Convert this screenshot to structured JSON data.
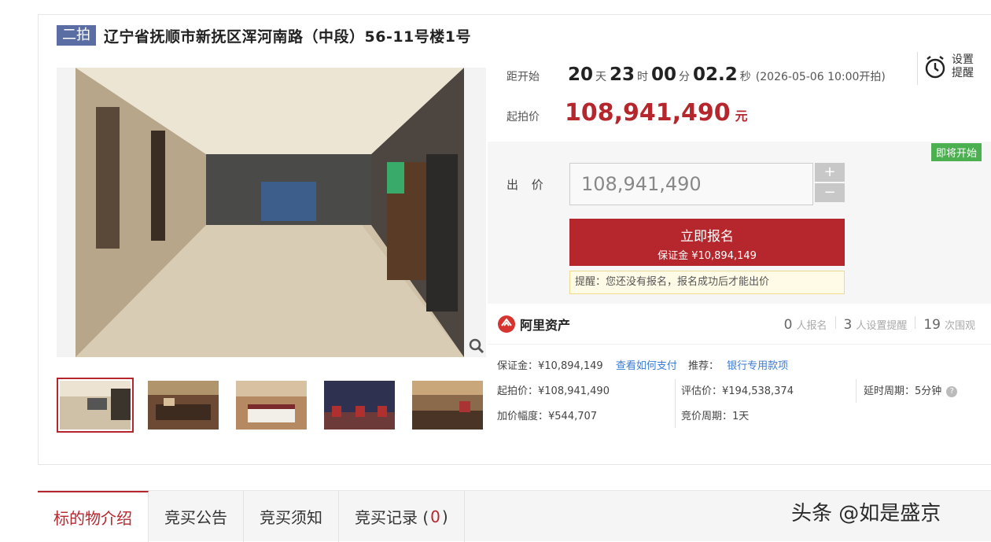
{
  "title": {
    "badge": "二拍",
    "text": "辽宁省抚顺市新抚区浑河南路（中段）56-11号楼1号"
  },
  "countdown": {
    "label": "距开始",
    "days": "20",
    "days_unit": "天",
    "hours": "23",
    "hours_unit": "时",
    "minutes": "00",
    "minutes_unit": "分",
    "seconds": "02.2",
    "seconds_unit": "秒",
    "note": "(2026-05-06 10:00开拍)"
  },
  "alarm": {
    "line1": "设置",
    "line2": "提醒"
  },
  "start_price": {
    "label": "起拍价",
    "value": "108,941,490",
    "unit": "元"
  },
  "status_tag": "即将开始",
  "bid": {
    "label": "出 价",
    "value": "108,941,490",
    "plus": "+",
    "minus": "−",
    "signup_label": "立即报名",
    "deposit_note": "保证金 ¥10,894,149",
    "reminder": "提醒：您还没有报名，报名成功后才能出价"
  },
  "platform": {
    "name": "阿里资产"
  },
  "stats": {
    "signups": "0",
    "signups_label": "人报名",
    "reminders": "3",
    "reminders_label": "人设置提醒",
    "views": "19",
    "views_label": "次围观"
  },
  "details": {
    "deposit": "保证金：¥10,894,149",
    "how_to_pay": "查看如何支付",
    "recommend_label": "推荐：",
    "recommend_link": "银行专用款项",
    "start_price": "起拍价：¥108,941,490",
    "appraisal": "评估价：¥194,538,374",
    "delay": "延时周期：5分钟",
    "increment": "加价幅度：¥544,707",
    "cycle": "竞价周期：1天"
  },
  "tabs": [
    {
      "label": "标的物介绍"
    },
    {
      "label": "竞买公告"
    },
    {
      "label": "竞买须知"
    },
    {
      "label": "竞买记录 (",
      "count": "0",
      "suffix": ")"
    }
  ],
  "watermark": "头条 @如是盛京",
  "colors": {
    "accent": "#b5272d",
    "badge": "#5b6ea3",
    "status_green": "#4caf50",
    "link": "#3a7bd5"
  }
}
